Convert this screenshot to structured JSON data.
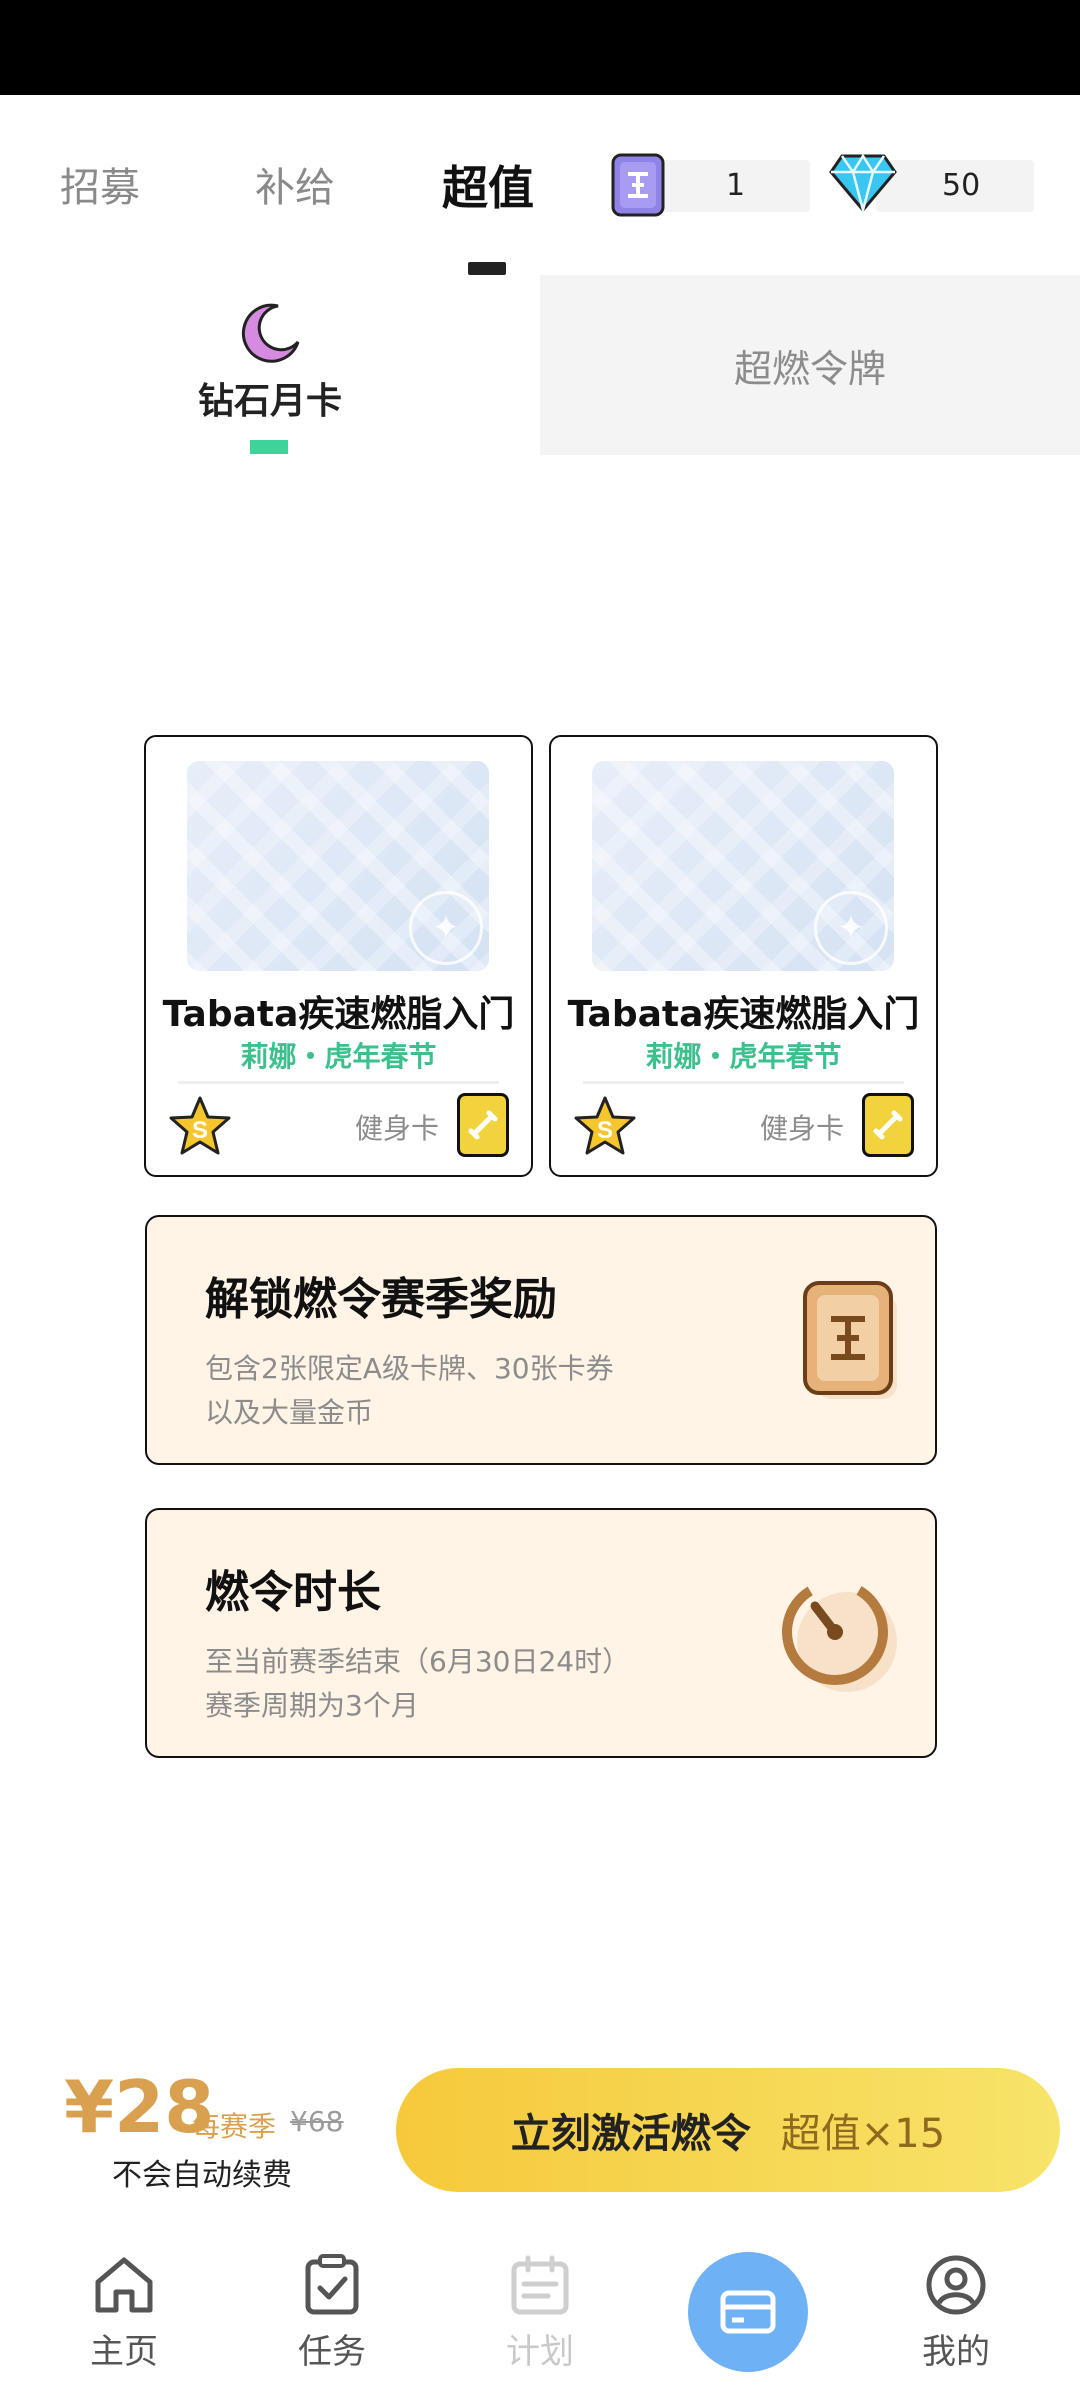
{
  "top_tabs": [
    {
      "label": "招募"
    },
    {
      "label": "补给"
    },
    {
      "label": "超值"
    }
  ],
  "currency": {
    "token_count": "1",
    "diamond_count": "50"
  },
  "sub_tabs": {
    "left": "钻石月卡",
    "right": "超燃令牌"
  },
  "reward_cards": [
    {
      "title": "Tabata疾速燃脂入门",
      "subtitle": "莉娜・虎年春节",
      "badge": "S",
      "kind": "健身卡"
    },
    {
      "title": "Tabata疾速燃脂入门",
      "subtitle": "莉娜・虎年春节",
      "badge": "S",
      "kind": "健身卡"
    }
  ],
  "info_boxes": [
    {
      "title": "解锁燃令赛季奖励",
      "line1": "包含2张限定A级卡牌、30张卡券",
      "line2": "以及大量金币",
      "icon": "token-card-icon"
    },
    {
      "title": "燃令时长",
      "line1": "至当前赛季结束（6月30日24时）",
      "line2": "赛季周期为3个月",
      "icon": "timer-icon"
    }
  ],
  "purchase": {
    "price": "¥28",
    "per": "每赛季",
    "original": "¥68",
    "note": "不会自动续费",
    "cta_main": "立刻激活燃令",
    "cta_sub": "超值×15"
  },
  "bottom_nav": [
    {
      "label": "主页",
      "icon": "home-icon"
    },
    {
      "label": "任务",
      "icon": "task-check-icon"
    },
    {
      "label": "计划",
      "icon": "calendar-icon"
    },
    {
      "label": "",
      "icon": "card-icon"
    },
    {
      "label": "我的",
      "icon": "profile-icon"
    }
  ],
  "colors": {
    "accent_green": "#3ed39b",
    "price_gold": "#d9a14f",
    "cta_yellow": "#f6c93b",
    "fab_blue": "#6fb1f5",
    "info_bg": "#fff4e6"
  }
}
